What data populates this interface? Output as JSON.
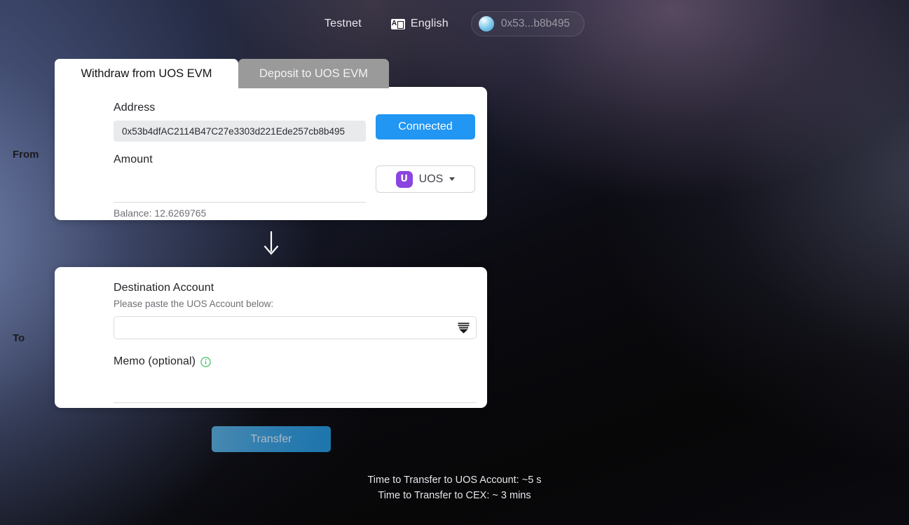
{
  "topbar": {
    "network_label": "Testnet",
    "language_label": "English",
    "language_icon": "translate-icon",
    "wallet_icon": "wallet-orb-icon",
    "wallet_address_short": "0x53...b8b495"
  },
  "tabs": [
    {
      "label": "Withdraw from UOS EVM",
      "active": true
    },
    {
      "label": "Deposit to UOS EVM",
      "active": false
    }
  ],
  "from": {
    "side_label": "From",
    "address_label": "Address",
    "address_value": "0x53b4dfAC2114B47C27e3303d221Ede257cb8b495",
    "connect_button_label": "Connected",
    "amount_label": "Amount",
    "amount_value": "",
    "amount_placeholder": "",
    "balance_text": "Balance: 12.6269765",
    "token_symbol": "UOS",
    "token_icon": "uos-token-icon",
    "token_glyph": "U",
    "caret_icon": "caret-down-icon"
  },
  "flow_arrow_icon": "arrow-down-icon",
  "to": {
    "side_label": "To",
    "destination_label": "Destination Account",
    "destination_hint": "Please paste the UOS Account below:",
    "destination_value": "",
    "destination_placeholder": "",
    "destination_dropdown_icon": "stacked-chevron-icon",
    "memo_label": "Memo (optional)",
    "memo_info_icon": "info-icon",
    "memo_value": "",
    "memo_placeholder": ""
  },
  "action": {
    "transfer_label": "Transfer"
  },
  "footnotes": {
    "line1": "Time to Transfer to UOS Account: ~5 s",
    "line2": "Time to Transfer to CEX: ~ 3 mins"
  },
  "colors": {
    "accent_blue": "#2196f3",
    "token_purple": "#8b45e0",
    "info_green": "#4cc46a",
    "tab_inactive": "#9a9a9a",
    "transfer_blue": "#2f86bd"
  }
}
